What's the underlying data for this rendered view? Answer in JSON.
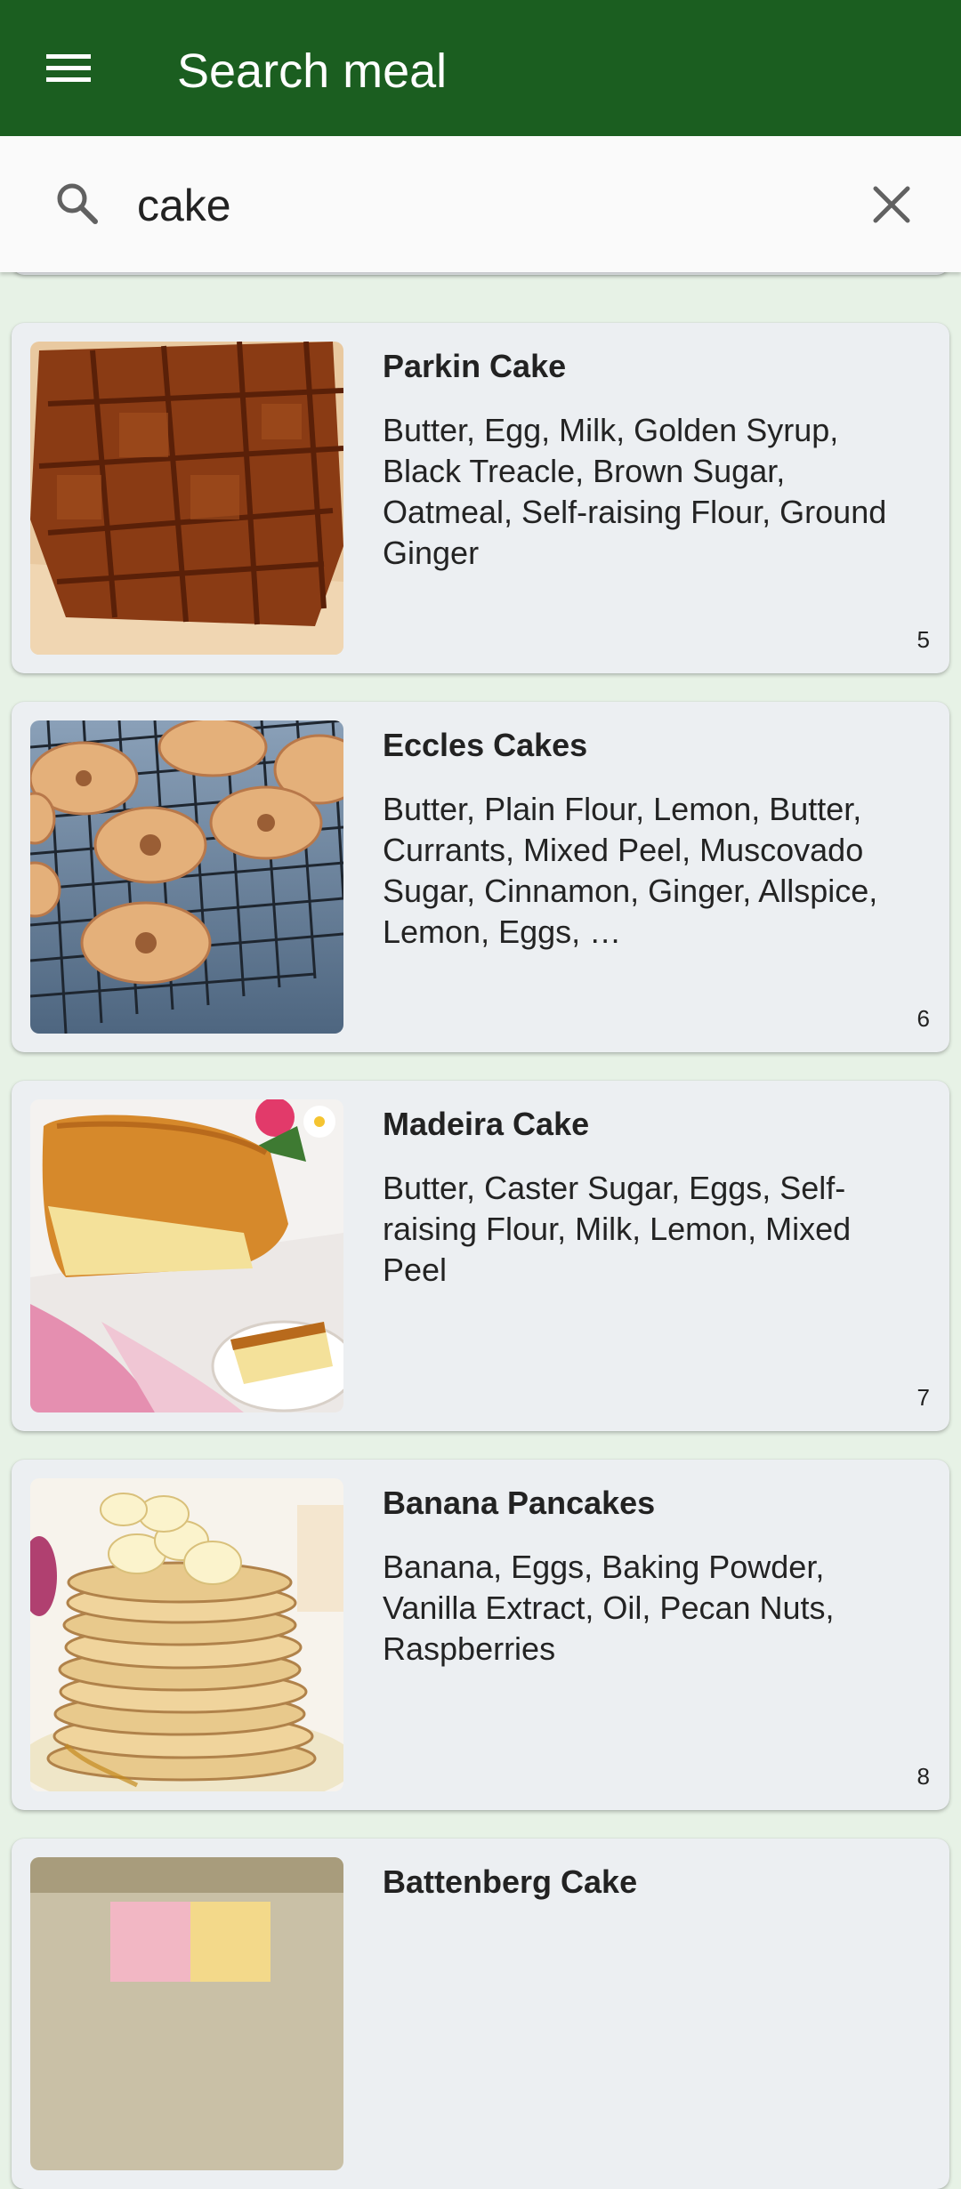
{
  "app_bar": {
    "title": "Search meal",
    "menu_icon": "menu-icon",
    "background_color": "#1b5e20"
  },
  "search": {
    "value": "cake",
    "search_icon": "search-icon",
    "clear_icon": "close-icon"
  },
  "meals": [
    {
      "name": "Parkin Cake",
      "ingredients": "Butter, Egg, Milk, Golden Syrup, Black Treacle, Brown Sugar, Oatmeal, Self-raising Flour, Ground Ginger",
      "index": "5",
      "image": "parkin-cake-photo"
    },
    {
      "name": "Eccles Cakes",
      "ingredients": "Butter, Plain Flour, Lemon, Butter, Currants, Mixed Peel, Muscovado Sugar, Cinnamon, Ginger, Allspice, Lemon, Eggs, …",
      "index": "6",
      "image": "eccles-cakes-photo"
    },
    {
      "name": "Madeira Cake",
      "ingredients": "Butter, Caster Sugar, Eggs, Self-raising Flour, Milk, Lemon, Mixed Peel",
      "index": "7",
      "image": "madeira-cake-photo"
    },
    {
      "name": "Banana Pancakes",
      "ingredients": "Banana, Eggs, Baking Powder, Vanilla Extract, Oil, Pecan Nuts, Raspberries",
      "index": "8",
      "image": "banana-pancakes-photo"
    },
    {
      "name": "Battenberg Cake",
      "image": "battenberg-cake-photo"
    }
  ]
}
